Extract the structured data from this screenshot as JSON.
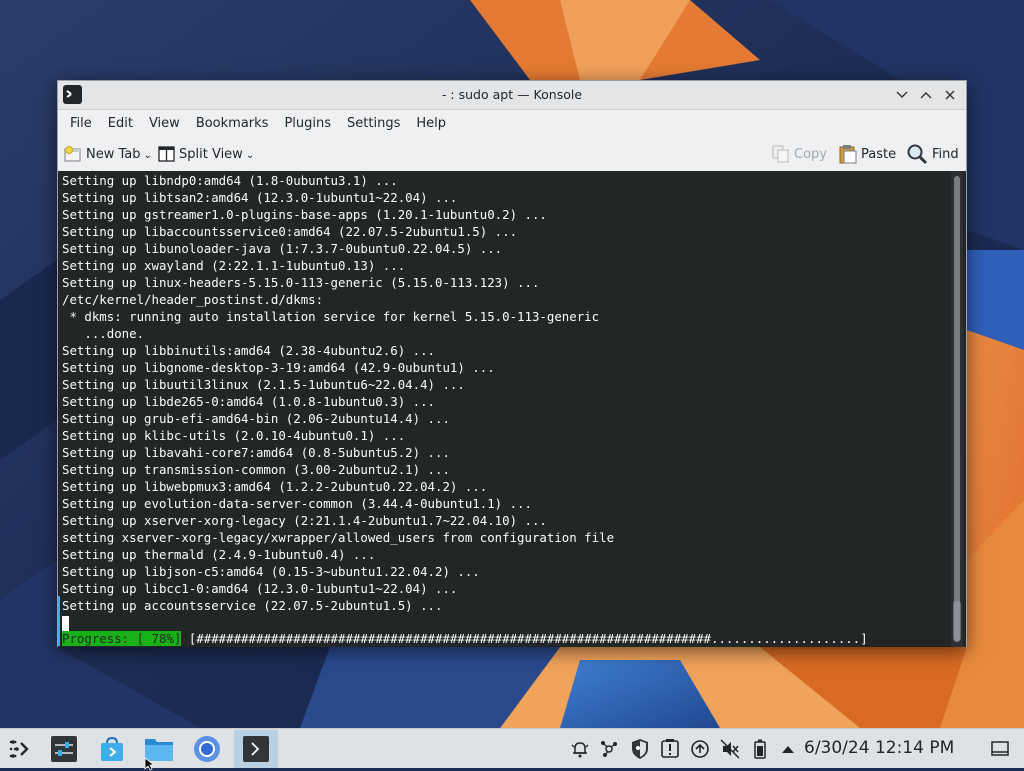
{
  "window": {
    "title": "- : sudo apt — Konsole"
  },
  "menubar": [
    "File",
    "Edit",
    "View",
    "Bookmarks",
    "Plugins",
    "Settings",
    "Help"
  ],
  "toolbar": {
    "new_tab": "New Tab",
    "split_view": "Split View",
    "copy": "Copy",
    "paste": "Paste",
    "find": "Find"
  },
  "terminal": {
    "lines": [
      "Setting up libndp0:amd64 (1.8-0ubuntu3.1) ...",
      "Setting up libtsan2:amd64 (12.3.0-1ubuntu1~22.04) ...",
      "Setting up gstreamer1.0-plugins-base-apps (1.20.1-1ubuntu0.2) ...",
      "Setting up libaccountsservice0:amd64 (22.07.5-2ubuntu1.5) ...",
      "Setting up libunoloader-java (1:7.3.7-0ubuntu0.22.04.5) ...",
      "Setting up xwayland (2:22.1.1-1ubuntu0.13) ...",
      "Setting up linux-headers-5.15.0-113-generic (5.15.0-113.123) ...",
      "/etc/kernel/header_postinst.d/dkms:",
      " * dkms: running auto installation service for kernel 5.15.0-113-generic",
      "   ...done.",
      "Setting up libbinutils:amd64 (2.38-4ubuntu2.6) ...",
      "Setting up libgnome-desktop-3-19:amd64 (42.9-0ubuntu1) ...",
      "Setting up libuutil3linux (2.1.5-1ubuntu6~22.04.4) ...",
      "Setting up libde265-0:amd64 (1.0.8-1ubuntu0.3) ...",
      "Setting up grub-efi-amd64-bin (2.06-2ubuntu14.4) ...",
      "Setting up klibc-utils (2.0.10-4ubuntu0.1) ...",
      "Setting up libavahi-core7:amd64 (0.8-5ubuntu5.2) ...",
      "Setting up transmission-common (3.00-2ubuntu2.1) ...",
      "Setting up libwebpmux3:amd64 (1.2.2-2ubuntu0.22.04.2) ...",
      "Setting up evolution-data-server-common (3.44.4-0ubuntu1.1) ...",
      "Setting up xserver-xorg-legacy (2:21.1.4-2ubuntu1.7~22.04.10) ...",
      "setting xserver-xorg-legacy/xwrapper/allowed_users from configuration file",
      "Setting up thermald (2.4.9-1ubuntu0.4) ...",
      "Setting up libjson-c5:amd64 (0.15-3~ubuntu1.22.04.2) ...",
      "Setting up libcc1-0:amd64 (12.3.0-1ubuntu1~22.04) ...",
      "Setting up accountsservice (22.07.5-2ubuntu1.5) ..."
    ],
    "progress_label": "Progress: [ 78%]",
    "progress_bar": " [#####################################################################....................]",
    "progress_percent": 78
  },
  "taskbar": {
    "clock": "6/30/24  12:14 PM"
  },
  "icons": {
    "launcher": "application-launcher-icon",
    "system_settings": "system-settings-icon",
    "discover": "discover-store-icon",
    "file_manager": "dolphin-folder-icon",
    "browser": "chromium-browser-icon",
    "terminal": "konsole-terminal-icon"
  },
  "colors": {
    "terminal_bg": "#232627",
    "terminal_fg": "#fcfcfc",
    "progress_green": "#18b218",
    "accent": "#3daee9"
  }
}
